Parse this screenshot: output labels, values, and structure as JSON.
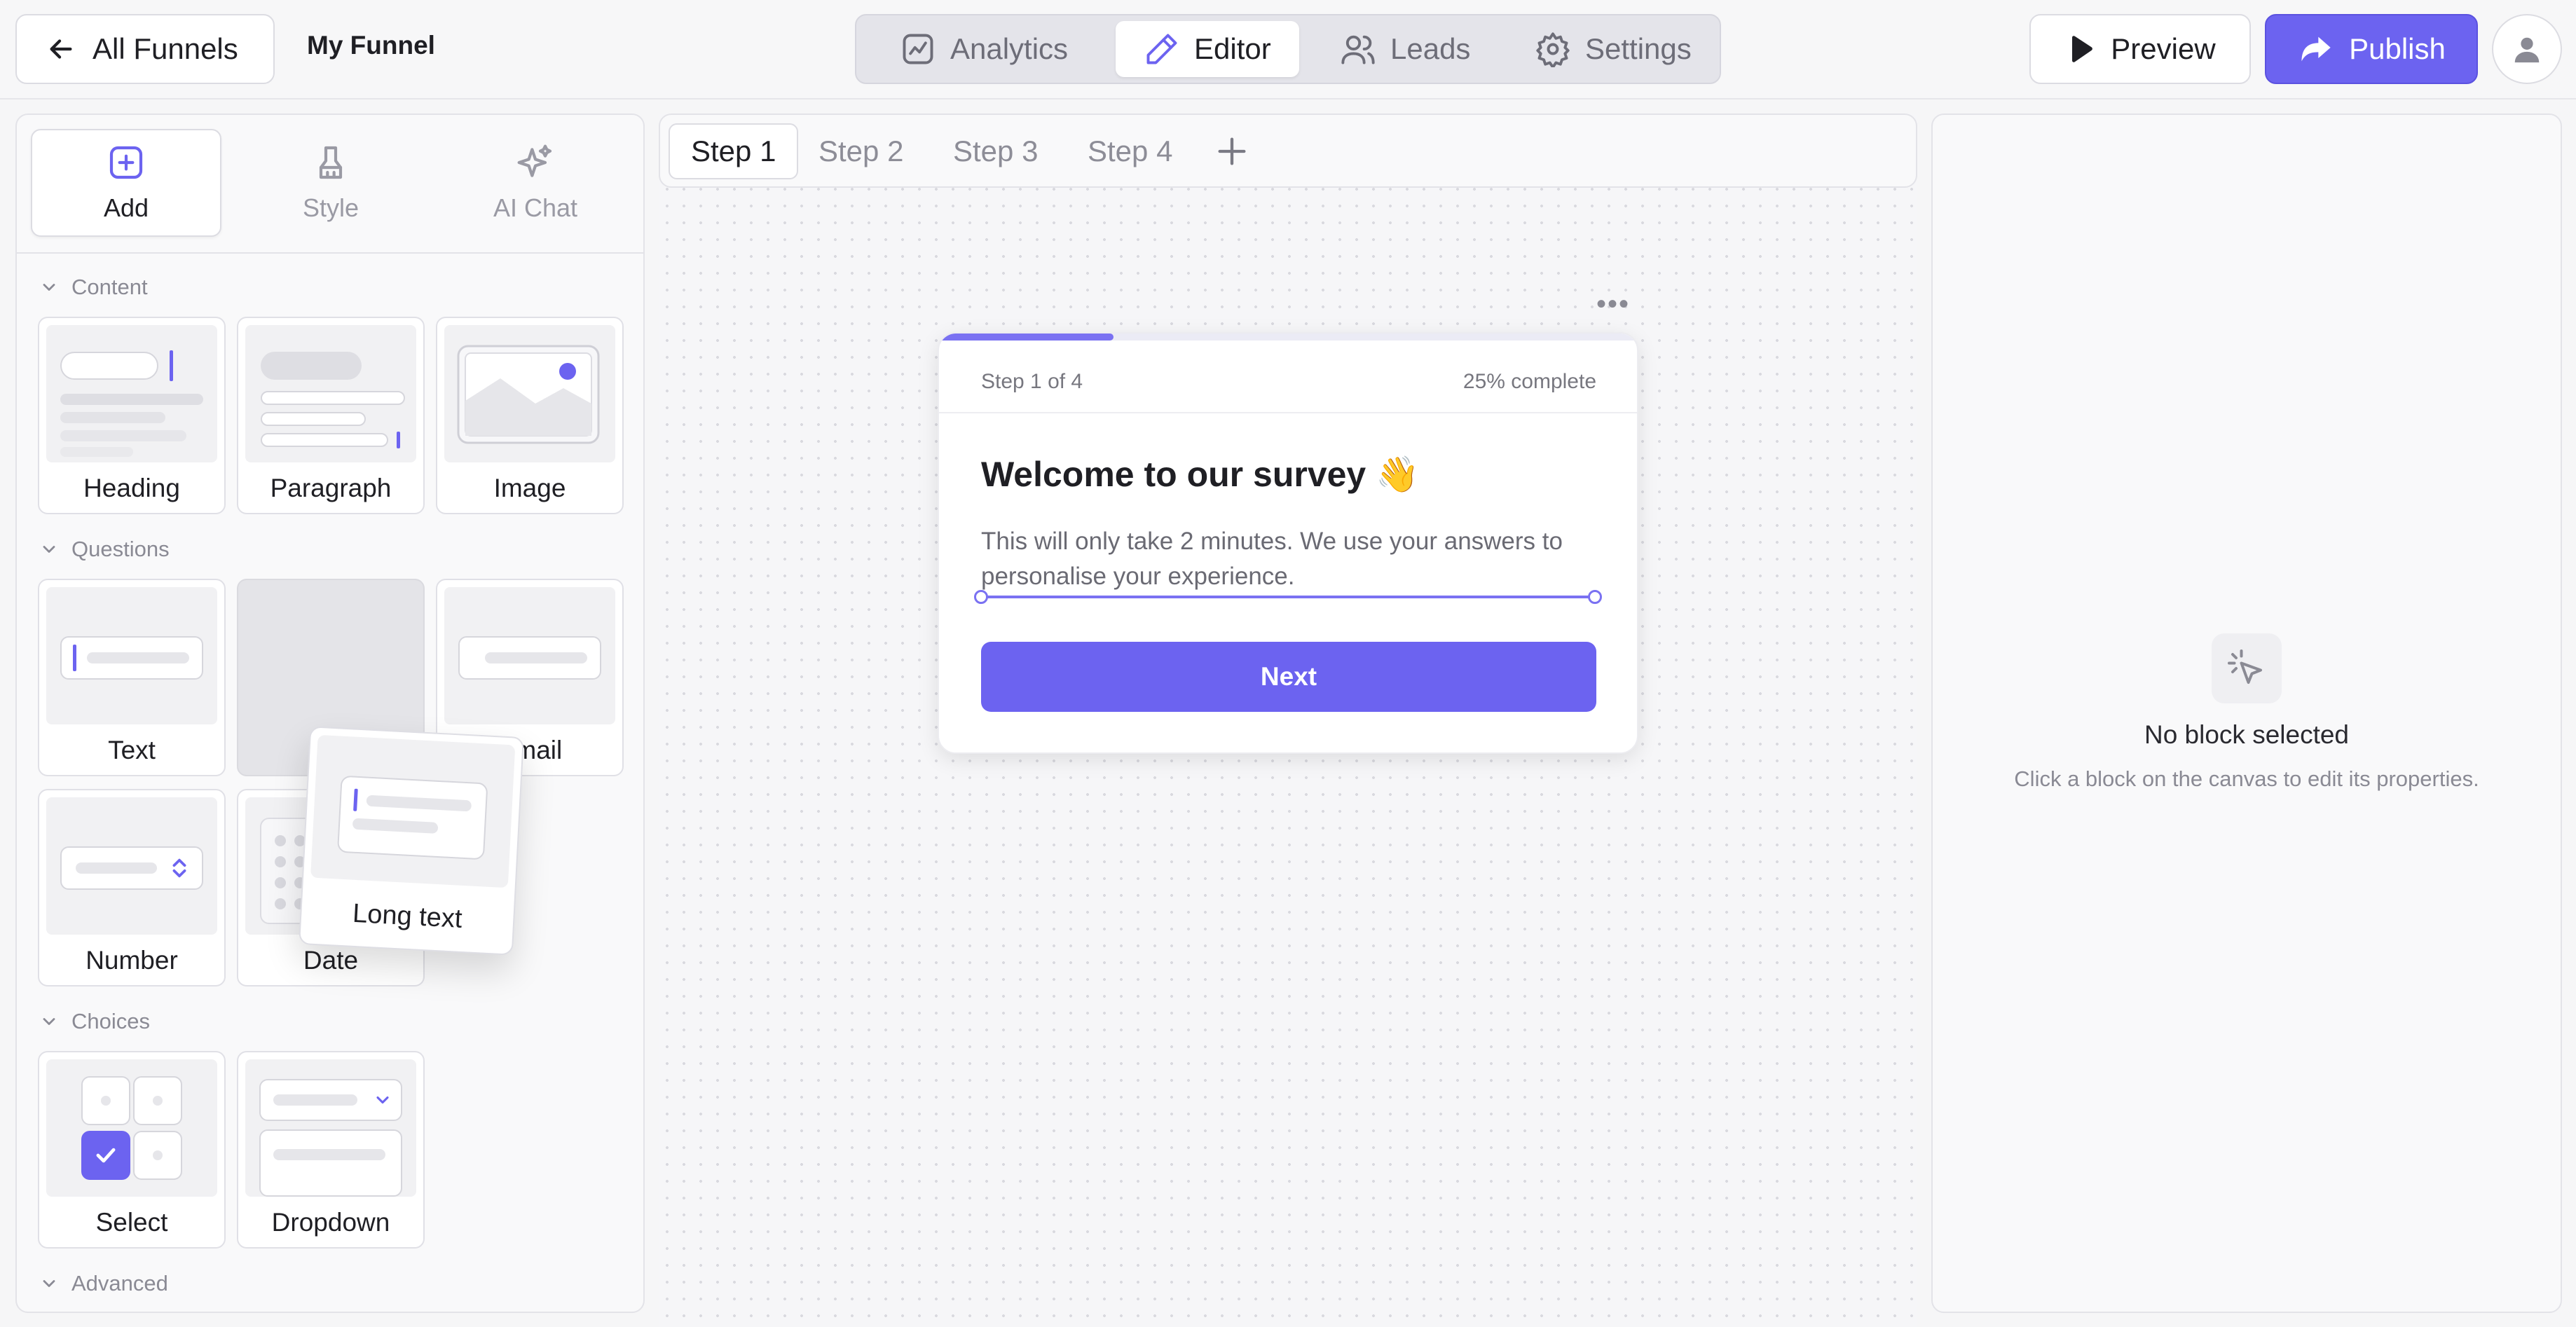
{
  "topbar": {
    "back_label": "All Funnels",
    "funnel_name": "My Funnel",
    "nav": [
      {
        "label": "Analytics",
        "icon": "chart-icon"
      },
      {
        "label": "Editor",
        "icon": "pencil-icon"
      },
      {
        "label": "Leads",
        "icon": "users-icon"
      },
      {
        "label": "Settings",
        "icon": "gear-icon"
      }
    ],
    "active_nav": "Editor",
    "preview_label": "Preview",
    "publish_label": "Publish"
  },
  "left_panel": {
    "tabs": [
      {
        "label": "Add",
        "icon": "plus-square-icon"
      },
      {
        "label": "Style",
        "icon": "brush-icon"
      },
      {
        "label": "AI Chat",
        "icon": "sparkles-icon"
      }
    ],
    "active_tab": "Add",
    "sections": {
      "content": "Content",
      "questions": "Questions",
      "choices": "Choices",
      "advanced": "Advanced"
    },
    "blocks": {
      "heading": "Heading",
      "paragraph": "Paragraph",
      "image": "Image",
      "text": "Text",
      "long_text": "Long text",
      "email": "Email",
      "number": "Number",
      "date": "Date",
      "select": "Select",
      "dropdown": "Dropdown"
    },
    "dragging_block": "Long text"
  },
  "canvas": {
    "steps": [
      "Step 1",
      "Step 2",
      "Step 3",
      "Step 4"
    ],
    "active_step": "Step 1",
    "card": {
      "step_of": "Step 1 of 4",
      "percent_complete": "25% complete",
      "progress_fraction": 0.25,
      "title": "Welcome to our survey 👋",
      "description": "This will only take 2 minutes. We use your answers to personalise your experience.",
      "button_label": "Next"
    }
  },
  "right_panel": {
    "empty_title": "No block selected",
    "empty_subtitle": "Click a block on the canvas to edit its properties."
  },
  "colors": {
    "accent": "#6c63f0",
    "accent_light": "#7a71f2"
  }
}
